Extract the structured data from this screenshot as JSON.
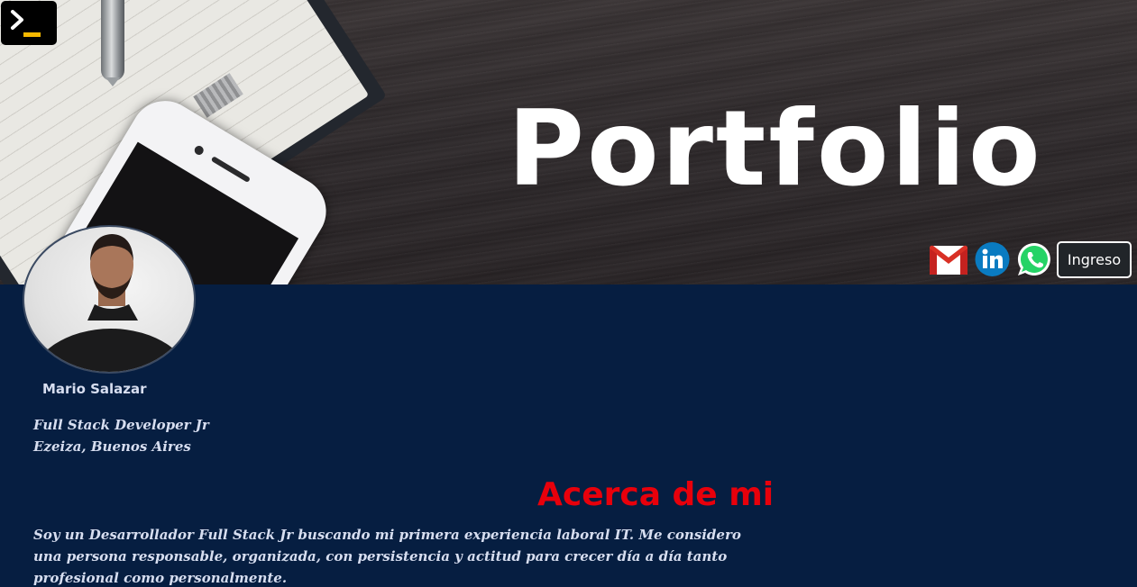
{
  "banner": {
    "title": "Portfolio"
  },
  "header": {
    "logo_icon": "terminal-icon",
    "social": [
      {
        "icon": "gmail-icon",
        "label": "Gmail"
      },
      {
        "icon": "linkedin-icon",
        "label": "LinkedIn"
      },
      {
        "icon": "whatsapp-icon",
        "label": "WhatsApp"
      }
    ],
    "login_label": "Ingreso"
  },
  "profile": {
    "name": "Mario Salazar",
    "role": "Full Stack Developer Jr",
    "location": "Ezeiza, Buenos Aires"
  },
  "about": {
    "title": "Acerca de mi",
    "text": "Soy un Desarrollador Full Stack Jr buscando mi primera experiencia laboral IT. Me considero una persona responsable, organizada, con persistencia y actitud para crecer día a día tanto profesional como personalmente."
  },
  "colors": {
    "background": "#061e41",
    "accent_red": "#e8000b",
    "text": "#d7def0",
    "logo_yellow": "#f5b800"
  }
}
